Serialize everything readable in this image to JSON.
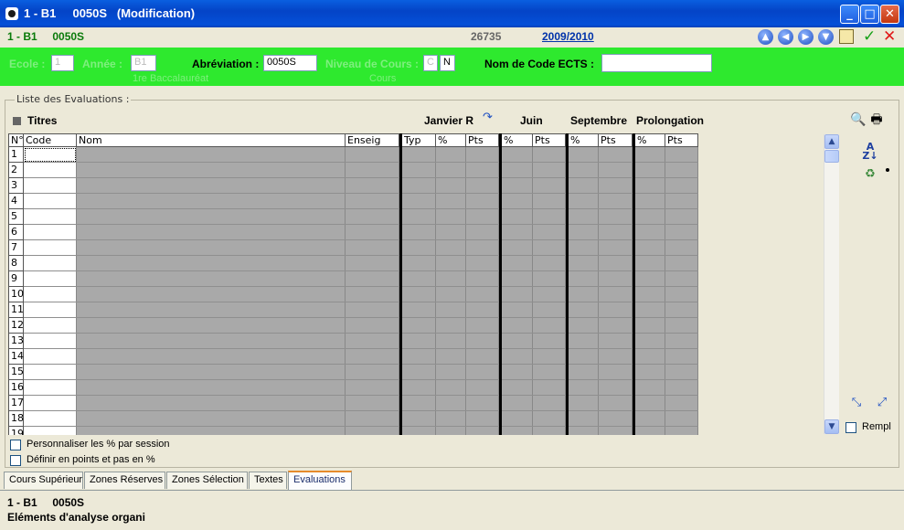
{
  "window": {
    "title": "1 - B1     0050S   (Modification)",
    "minimize": "_",
    "maximize": "□",
    "close": "✕"
  },
  "toolbar": {
    "breadcrumb": "1 - B1     0050S",
    "record_number": "26735",
    "academic_year": "2009/2010",
    "icons": [
      "arrow-up-icon",
      "arrow-left-icon",
      "arrow-right-icon",
      "arrow-down-icon",
      "calculator-icon",
      "check-icon",
      "cancel-icon"
    ],
    "check_glyph": "✓",
    "cancel_glyph": "✕"
  },
  "header": {
    "ecole_label": "Ecole :",
    "ecole_value": "1",
    "annee_label": "Année :",
    "annee_value": "B1",
    "annee_sub": "1re Baccalauréat",
    "abbrev_label": "Abréviation :",
    "abbrev_value": "0050S",
    "niveau_label": "Niveau de Cours :",
    "niveau_value1": "C",
    "niveau_value2": "N",
    "niveau_sub": "Cours",
    "ects_label": "Nom de Code ECTS :",
    "ects_value": ""
  },
  "evaluations": {
    "group_label": "Liste des Evaluations :",
    "titres_label": "Titres",
    "sessions": [
      "Janvier R",
      "Juin",
      "Septembre",
      "Prolongation"
    ],
    "columns": [
      "N°",
      "Code",
      "Nom",
      "Enseig",
      "Typ",
      "%",
      "Pts",
      "%",
      "Pts",
      "%",
      "Pts",
      "%",
      "Pts"
    ],
    "rows": [
      "1",
      "2",
      "3",
      "4",
      "5",
      "6",
      "7",
      "8",
      "9",
      "10",
      "11",
      "12",
      "13",
      "14",
      "15",
      "16",
      "17",
      "18",
      "19"
    ],
    "rempl_label": "Rempl",
    "custom_pct_label": "Personnaliser les % par session",
    "points_label": "Définir en points et pas en %"
  },
  "tabs": [
    "Cours Supérieur",
    "Zones Réserves",
    "Zones Sélection",
    "Textes",
    "Evaluations"
  ],
  "active_tab": "Evaluations",
  "status": {
    "line1": "1 - B1     0050S",
    "line2": "Eléments d'analyse organi"
  },
  "colors": {
    "title_bar": "#0a5fe0",
    "header_band": "#2ee92e",
    "grid_fill": "#a9a9a9",
    "breadcrumb_text": "#0a7a0a"
  }
}
